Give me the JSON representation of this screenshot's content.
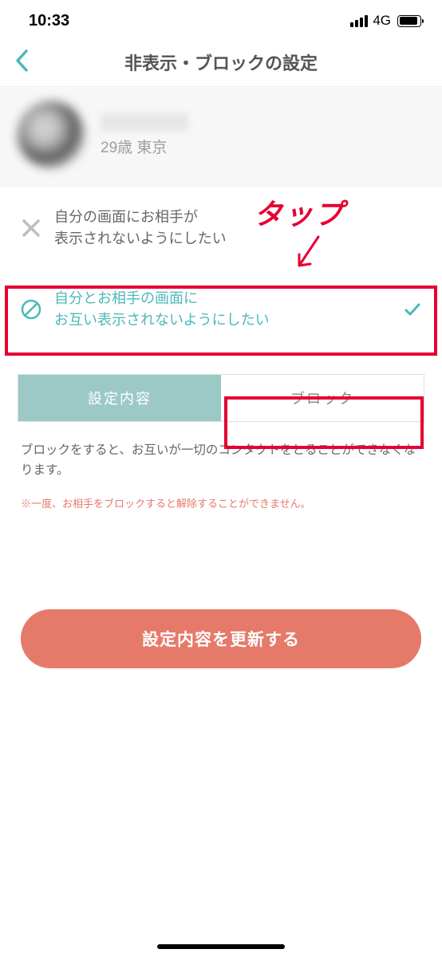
{
  "status": {
    "time": "10:33",
    "network": "4G"
  },
  "header": {
    "title": "非表示・ブロックの設定"
  },
  "profile": {
    "subtitle": "29歳 東京"
  },
  "options": {
    "hide_self": "自分の画面にお相手が\n表示されないようにしたい",
    "hide_both": "自分とお相手の画面に\nお互い表示されないようにしたい"
  },
  "annotation": {
    "tap": "タップ"
  },
  "tabs": {
    "settings": "設定内容",
    "block": "ブロック"
  },
  "info": {
    "description": "ブロックをすると、お互いが一切のコンタクトをとることができなくなります。",
    "warning": "※一度、お相手をブロックすると解除することができません。"
  },
  "button": {
    "update": "設定内容を更新する"
  }
}
